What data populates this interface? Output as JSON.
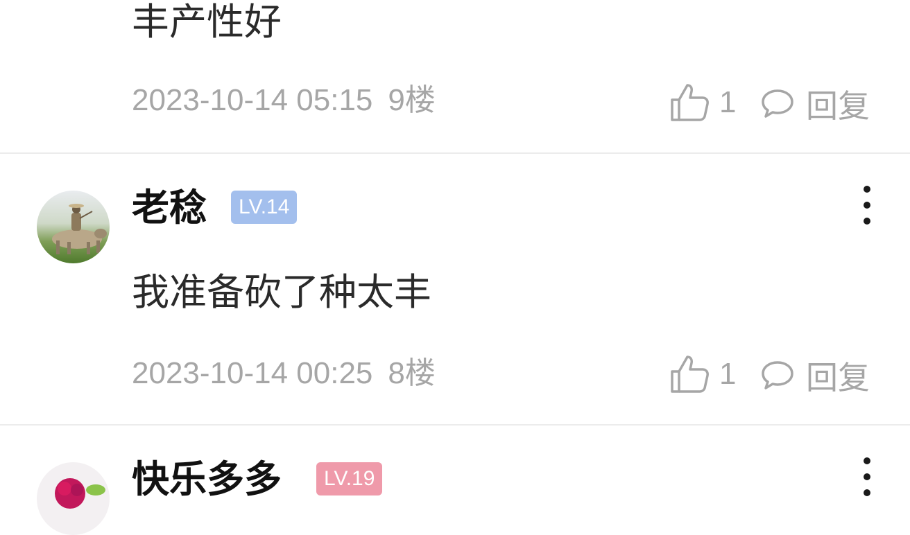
{
  "comments": [
    {
      "username": "",
      "level": "",
      "text": "丰产性好",
      "time": "2023-10-14 05:15",
      "floor": "9楼",
      "likes": "1",
      "reply_label": "回复"
    },
    {
      "username": "老稔",
      "level": "LV.14",
      "level_color": "#a3bfed",
      "text": "我准备砍了种太丰",
      "time": "2023-10-14 00:25",
      "floor": "8楼",
      "likes": "1",
      "reply_label": "回复"
    },
    {
      "username": "快乐多多",
      "level": "LV.19",
      "level_color": "#ef9aaa"
    }
  ],
  "icons": {
    "like": "thumbs-up-icon",
    "reply": "speech-bubble-icon",
    "more": "more-vertical-icon"
  }
}
